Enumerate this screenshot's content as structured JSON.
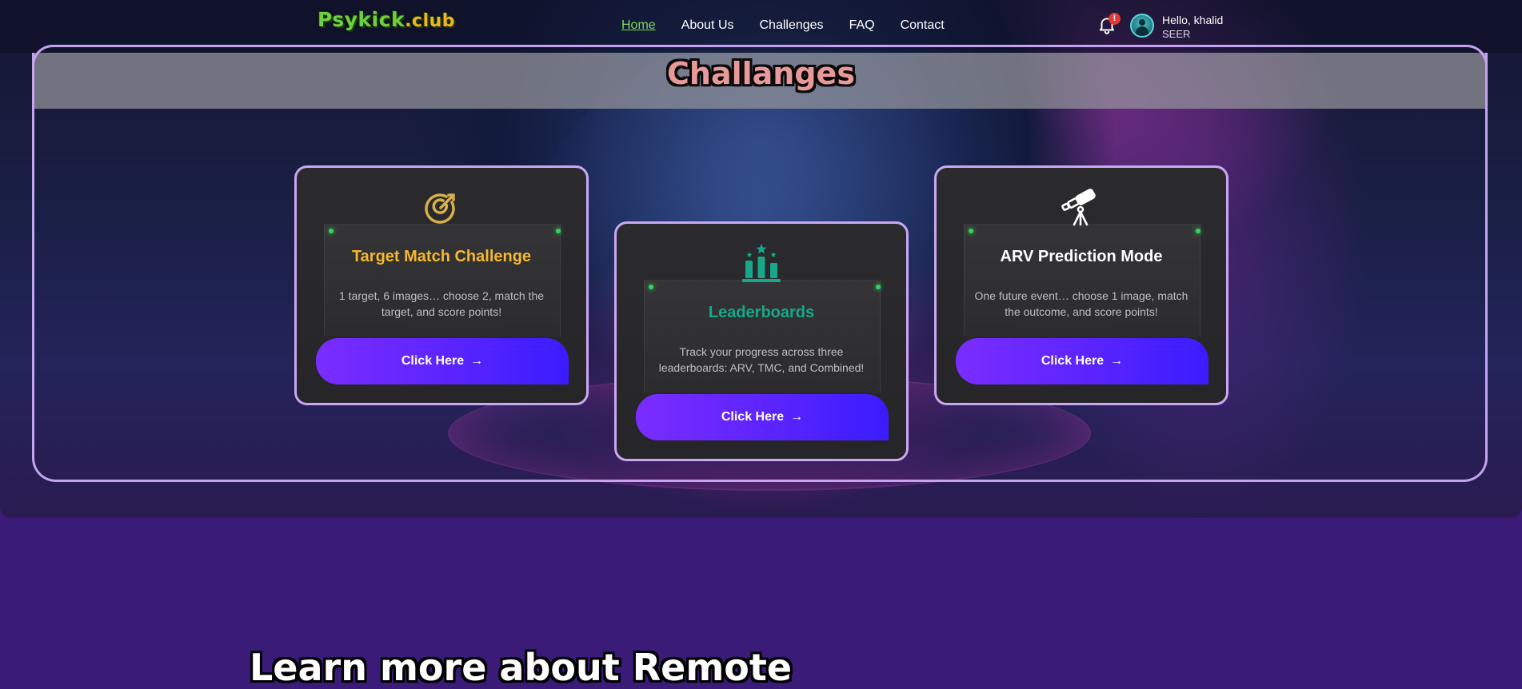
{
  "navbar": {
    "logo_main": "Psykick",
    "logo_tld": ".club",
    "links": [
      {
        "label": "Home",
        "active": true
      },
      {
        "label": "About Us",
        "active": false
      },
      {
        "label": "Challenges",
        "active": false
      },
      {
        "label": "FAQ",
        "active": false
      },
      {
        "label": "Contact",
        "active": false
      }
    ],
    "notification_badge": "!",
    "user_greeting": "Hello, khalid",
    "user_role": "SEER"
  },
  "challenges": {
    "title": "Challanges",
    "cards": [
      {
        "icon": "target-arrow-icon",
        "title": "Target Match Challenge",
        "title_color": "#f5b82e",
        "description": "1 target, 6 images… choose 2, match the target, and score points!",
        "button_label": "Click Here"
      },
      {
        "icon": "leaderboard-podium-icon",
        "title": "Leaderboards",
        "title_color": "#17a88a",
        "description": "Track your progress across three leaderboards: ARV, TMC, and Combined!",
        "button_label": "Click Here"
      },
      {
        "icon": "telescope-icon",
        "title": "ARV Prediction Mode",
        "title_color": "#ffffff",
        "description": "One future event… choose 1 image, match the outcome, and score points!",
        "button_label": "Click Here"
      }
    ]
  },
  "learn_more": {
    "heading": "Learn more about Remote"
  },
  "colors": {
    "accent_purple": "#7a2dff",
    "card_border": "#c9a8f3",
    "page_background": "#3a1b78",
    "nav_active": "#7ed957"
  }
}
